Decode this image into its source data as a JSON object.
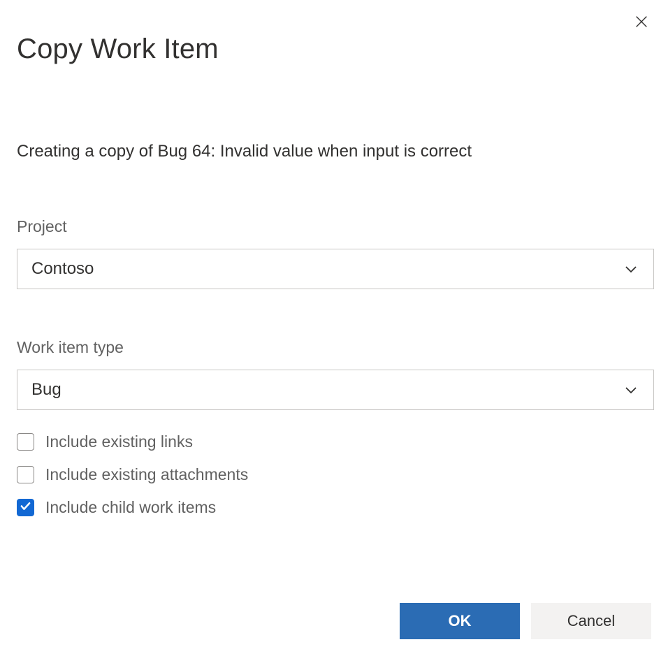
{
  "dialog": {
    "title": "Copy Work Item",
    "subtitle": "Creating a copy of Bug 64: Invalid value when input is correct"
  },
  "fields": {
    "project": {
      "label": "Project",
      "value": "Contoso"
    },
    "work_item_type": {
      "label": "Work item type",
      "value": "Bug"
    }
  },
  "checkboxes": {
    "include_links": {
      "label": "Include existing links",
      "checked": false
    },
    "include_attachments": {
      "label": "Include existing attachments",
      "checked": false
    },
    "include_children": {
      "label": "Include child work items",
      "checked": true
    }
  },
  "buttons": {
    "ok": "OK",
    "cancel": "Cancel"
  }
}
